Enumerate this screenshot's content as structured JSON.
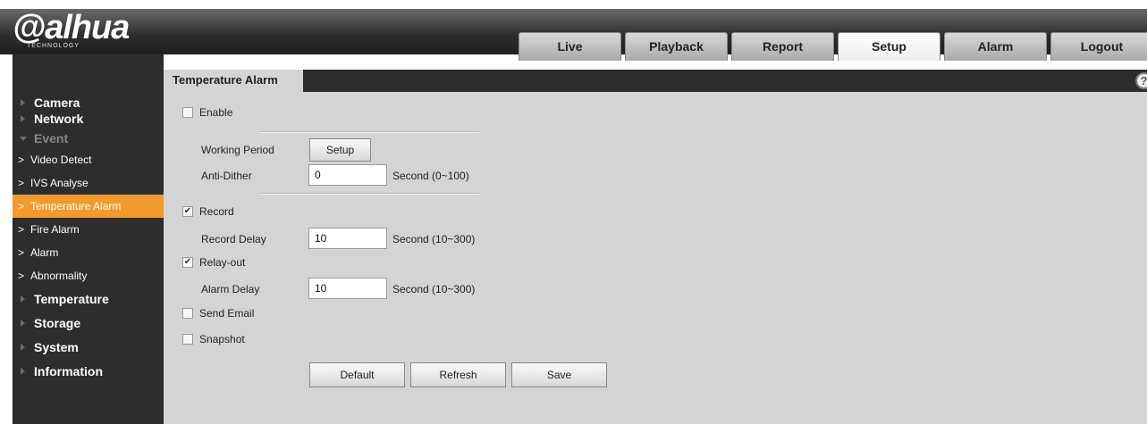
{
  "header": {
    "logo_text": "alhua",
    "logo_sub": "TECHNOLOGY",
    "tabs": [
      {
        "label": "Live"
      },
      {
        "label": "Playback"
      },
      {
        "label": "Report"
      },
      {
        "label": "Setup"
      },
      {
        "label": "Alarm"
      },
      {
        "label": "Logout"
      }
    ],
    "active_tab": "Setup"
  },
  "sidebar": {
    "items": [
      {
        "label": "Camera"
      },
      {
        "label": "Network"
      },
      {
        "label": "Event"
      },
      {
        "label": "Video Detect"
      },
      {
        "label": "IVS Analyse"
      },
      {
        "label": "Temperature Alarm"
      },
      {
        "label": "Fire Alarm"
      },
      {
        "label": "Alarm"
      },
      {
        "label": "Abnormality"
      },
      {
        "label": "Temperature"
      },
      {
        "label": "Storage"
      },
      {
        "label": "System"
      },
      {
        "label": "Information"
      }
    ],
    "active_item": "Temperature Alarm",
    "accent_color": "#f39a2d"
  },
  "main": {
    "title": "Temperature Alarm",
    "help_glyph": "?",
    "enable": {
      "label": "Enable",
      "checked": false
    },
    "working_period": {
      "label": "Working Period",
      "button": "Setup"
    },
    "anti_dither": {
      "label": "Anti-Dither",
      "value": "0",
      "unit": "Second (0~100)"
    },
    "record": {
      "label": "Record",
      "checked": true
    },
    "record_delay": {
      "label": "Record Delay",
      "value": "10",
      "unit": "Second (10~300)"
    },
    "relay_out": {
      "label": "Relay-out",
      "checked": true
    },
    "alarm_delay": {
      "label": "Alarm Delay",
      "value": "10",
      "unit": "Second (10~300)"
    },
    "send_email": {
      "label": "Send Email",
      "checked": false
    },
    "snapshot": {
      "label": "Snapshot",
      "checked": false
    },
    "buttons": {
      "default": "Default",
      "refresh": "Refresh",
      "save": "Save"
    },
    "check_glyph": "✔"
  }
}
